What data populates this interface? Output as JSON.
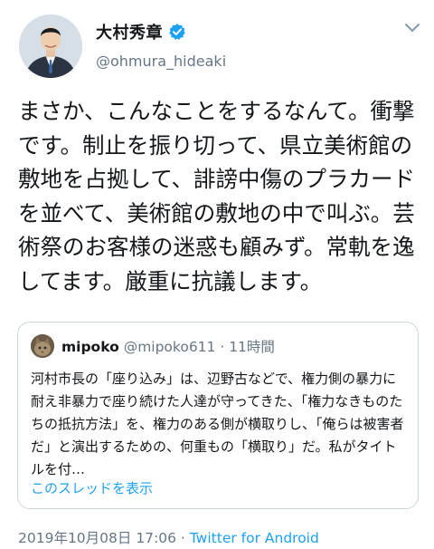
{
  "author": {
    "display_name": "大村秀章",
    "handle": "@ohmura_hideaki",
    "verified_icon": "verified-badge-icon"
  },
  "tweet": {
    "text": "まさか、こんなことをするなんて。衝撃です。制止を振り切って、県立美術館の敷地を占拠して、誹謗中傷のプラカードを並べて、美術館の敷地の中で叫ぶ。芸術祭のお客様の迷惑も顧みず。常軌を逸してます。厳重に抗議します。"
  },
  "quoted": {
    "name": "mipoko",
    "handle": "@mipoko611",
    "separator": " · ",
    "time": "11時間",
    "text": "河村市長の「座り込み」は、辺野古などで、権力側の暴力に耐え非暴力で座り続けた人達が守ってきた、「権力なきものたちの抵抗方法」を、権力のある側が横取りし、「俺らは被害者だ」と演出するための、何重もの「横取り」だ。私がタイトルを付…",
    "thread_link": "このスレッドを表示"
  },
  "footer": {
    "date": "2019年10月08日 17:06",
    "separator": " · ",
    "client": "Twitter for Android"
  },
  "colors": {
    "link": "#1da1f2",
    "secondary": "#657786",
    "border": "#ccd6dd"
  }
}
